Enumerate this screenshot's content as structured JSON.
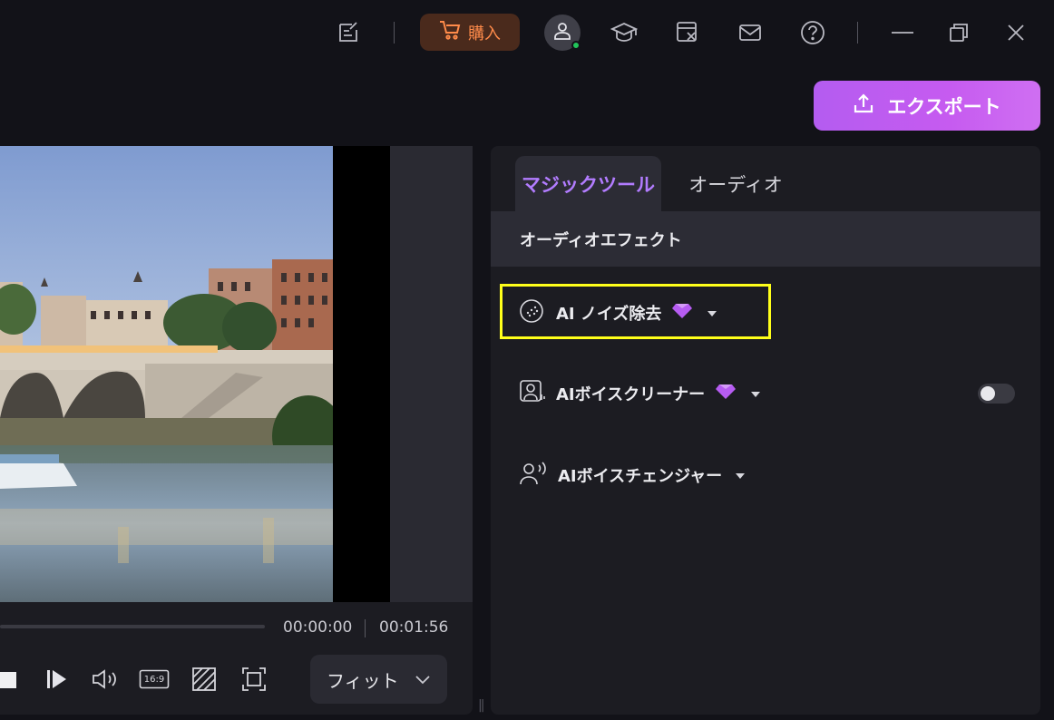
{
  "titlebar": {
    "buy_label": "購入",
    "icons": [
      "feedback-icon",
      "cart-icon",
      "user-icon",
      "learn-icon",
      "tools-icon",
      "mail-icon",
      "help-icon",
      "minimize-icon",
      "restore-icon",
      "close-icon"
    ]
  },
  "export": {
    "label": "エクスポート"
  },
  "preview": {
    "time_current": "00:00:00",
    "time_total": "00:01:56",
    "aspect_label": "16:9",
    "fit_label": "フィット"
  },
  "panel": {
    "tabs": [
      {
        "label": "マジックツール",
        "active": true
      },
      {
        "label": "オーディオ",
        "active": false
      }
    ],
    "section_title": "オーディオエフェクト",
    "features": [
      {
        "label": "AI ノイズ除去",
        "premium": true
      },
      {
        "label": "AIボイスクリーナー",
        "premium": true,
        "toggle": false
      },
      {
        "label": "AIボイスチェンジャー",
        "premium": false
      }
    ]
  },
  "colors": {
    "accent_purple": "#b27cff",
    "export_gradient": "#c65bf0",
    "buy_orange": "#ff8b4a",
    "highlight_yellow": "#ffff1a",
    "online_green": "#21c45a"
  }
}
